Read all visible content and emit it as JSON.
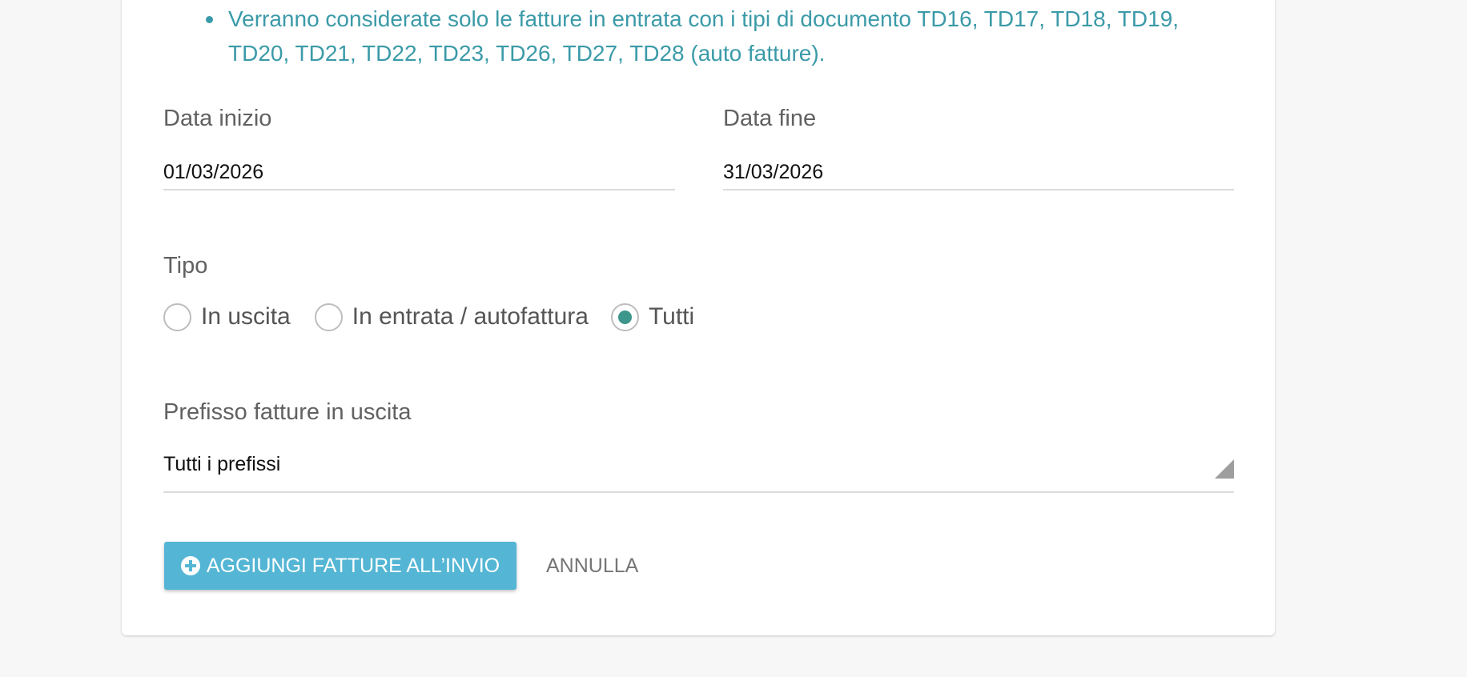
{
  "notes": [
    "Verranno considerate solo le fatture in entrata con i tipi di documento TD16, TD17, TD18, TD19, TD20, TD21, TD22, TD23, TD26, TD27, TD28 (auto fatture)."
  ],
  "start_date": {
    "label": "Data inizio",
    "value": "01/03/2026"
  },
  "end_date": {
    "label": "Data fine",
    "value": "31/03/2026"
  },
  "type": {
    "label": "Tipo",
    "options": [
      "In uscita",
      "In entrata / autofattura",
      "Tutti"
    ],
    "selected": "Tutti"
  },
  "prefix": {
    "label": "Prefisso fatture in uscita",
    "selected": "Tutti i prefissi"
  },
  "actions": {
    "add_label": "AGGIUNGI FATTURE ALL’INVIO",
    "cancel_label": "ANNULLA"
  },
  "colors": {
    "accent_teal": "#3b9aa8",
    "radio_checked": "#3d968c",
    "primary_button": "#54b6d4"
  },
  "icons": {
    "add_button_icon": "plus-circle-icon",
    "select_arrow": "triangle-down-icon",
    "note_bullet": "bullet-icon"
  }
}
